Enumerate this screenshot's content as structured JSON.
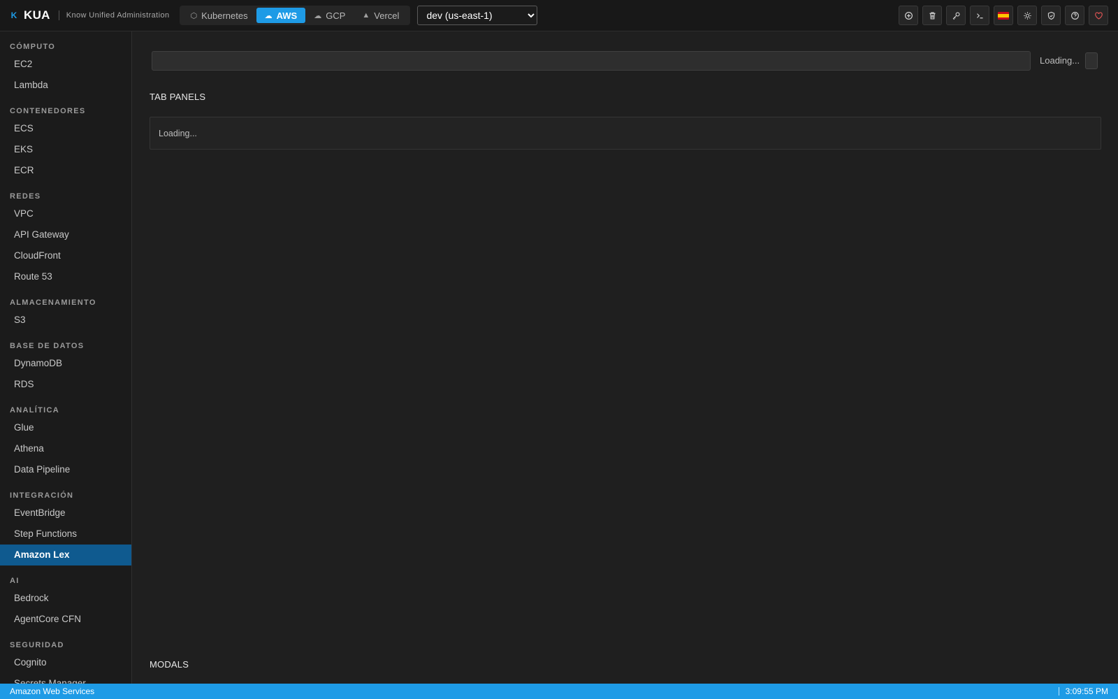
{
  "brand": {
    "logo_glyph": "K",
    "name": "KUA",
    "subtitle": "Know Unified Administration"
  },
  "providers": [
    {
      "label": "Kubernetes",
      "icon": "cube-icon",
      "glyph": "⬡",
      "active": false
    },
    {
      "label": "AWS",
      "icon": "cloud-icon",
      "glyph": "☁",
      "active": true
    },
    {
      "label": "GCP",
      "icon": "cloud-upload-icon",
      "glyph": "☁",
      "active": false
    },
    {
      "label": "Vercel",
      "icon": "triangle-icon",
      "glyph": "▲",
      "active": false
    }
  ],
  "environment": {
    "selected": "dev (us-east-1)"
  },
  "toolbar": [
    {
      "name": "add-context-icon"
    },
    {
      "name": "trash-icon"
    },
    {
      "name": "key-icon"
    },
    {
      "name": "terminal-icon"
    },
    {
      "name": "spain-flag-icon"
    },
    {
      "name": "sun-icon"
    },
    {
      "name": "shield-icon"
    },
    {
      "name": "help-icon"
    },
    {
      "name": "heart-icon"
    }
  ],
  "sidebar": {
    "groups": [
      {
        "title": "CÓMPUTO",
        "items": [
          "EC2",
          "Lambda"
        ]
      },
      {
        "title": "CONTENEDORES",
        "items": [
          "ECS",
          "EKS",
          "ECR"
        ]
      },
      {
        "title": "REDES",
        "items": [
          "VPC",
          "API Gateway",
          "CloudFront",
          "Route 53"
        ]
      },
      {
        "title": "ALMACENAMIENTO",
        "items": [
          "S3"
        ]
      },
      {
        "title": "BASE DE DATOS",
        "items": [
          "DynamoDB",
          "RDS"
        ]
      },
      {
        "title": "ANALÍTICA",
        "items": [
          "Glue",
          "Athena",
          "Data Pipeline"
        ]
      },
      {
        "title": "INTEGRACIÓN",
        "items": [
          "EventBridge",
          "Step Functions",
          "Amazon Lex"
        ]
      },
      {
        "title": "AI",
        "items": [
          "Bedrock",
          "AgentCore CFN"
        ]
      },
      {
        "title": "SEGURIDAD",
        "items": [
          "Cognito",
          "Secrets Manager"
        ]
      }
    ],
    "active_item": "Amazon Lex"
  },
  "main": {
    "search_value": "",
    "loading_label": "Loading...",
    "tab_panels_label": "TAB PANELS",
    "panel_loading": "Loading...",
    "modals_label": "MODALS"
  },
  "status": {
    "left": "Amazon Web Services",
    "time": "3:09:55 PM"
  },
  "colors": {
    "accent": "#1e9be6",
    "active_nav": "#0f5a8f",
    "background": "#1f1f1f"
  }
}
